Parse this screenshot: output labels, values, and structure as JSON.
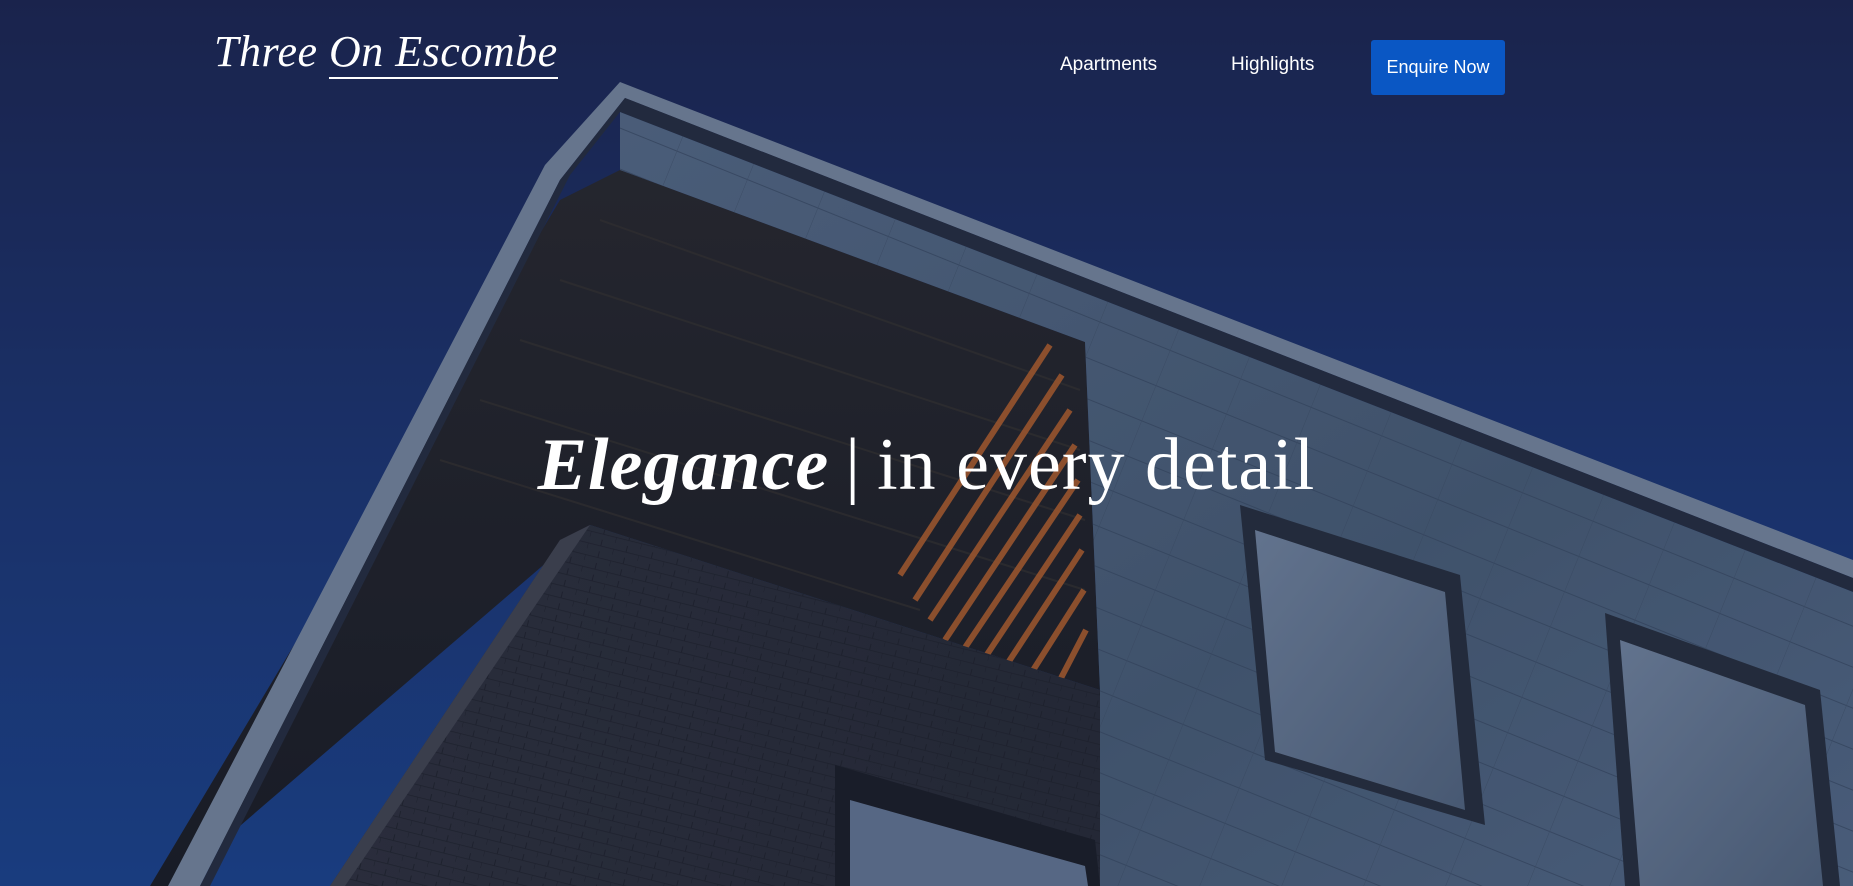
{
  "brand": {
    "part1": "Three",
    "part2": "On Escombe"
  },
  "nav": {
    "items": [
      {
        "label": "Apartments"
      },
      {
        "label": "Highlights"
      }
    ],
    "cta_label": "Enquire Now",
    "cta_color": "#0a57c4"
  },
  "hero": {
    "headline_emphasis": "Elegance",
    "headline_separator": "|",
    "headline_rest": "in every detail",
    "background": "building-photo"
  },
  "colors": {
    "sky_top": "#1f2b57",
    "sky_bottom": "#1d4794",
    "text": "#ffffff"
  }
}
